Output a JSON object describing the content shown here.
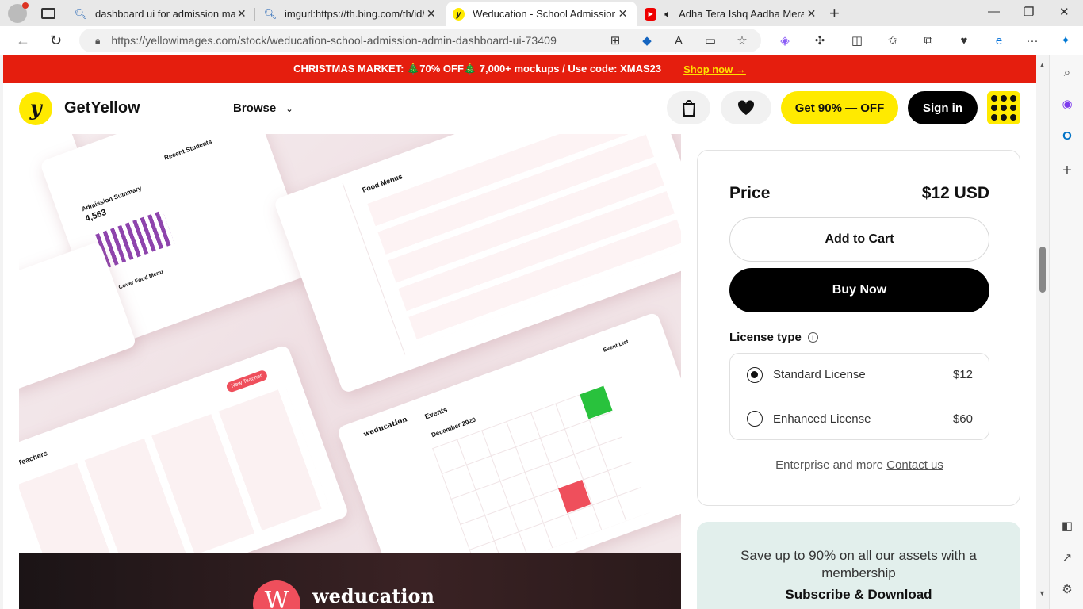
{
  "browser": {
    "tabs": [
      {
        "title": "dashboard ui for admission man",
        "icon": "search-icon"
      },
      {
        "title": "imgurl:https://th.bing.com/th/id/",
        "icon": "search-icon"
      },
      {
        "title": "Weducation - School Admission",
        "icon": "getyellow-favicon"
      },
      {
        "title": "Adha Tera Ishq Aadha Mera",
        "icon": "youtube-icon"
      }
    ],
    "url": "https://yellowimages.com/stock/weducation-school-admission-admin-dashboard-ui-73409"
  },
  "promo": {
    "text": "CHRISTMAS MARKET: 🎄70% OFF🎄 7,000+ mockups / Use code: XMAS23",
    "link": "Shop now →"
  },
  "header": {
    "brand": "GetYellow",
    "logo_letter": "y",
    "browse": "Browse",
    "deal_button": "Get 90% — OFF",
    "signin_button": "Sign in"
  },
  "preview": {
    "brand_name": "weducation",
    "brand_letter": "W",
    "labels": {
      "admission": "Admission Summary",
      "admission_value": "4,563",
      "recent_students": "Recent Students",
      "cover_food": "Cover Food Menu",
      "food_menus": "Food Menus",
      "teachers": "Teachers",
      "events": "Events",
      "month": "December 2020",
      "new_teacher": "New Teacher",
      "event_list": "Event List",
      "weducation_card": "weducation"
    }
  },
  "product": {
    "price_label": "Price",
    "price_value": "$12 USD",
    "add_to_cart": "Add to Cart",
    "buy_now": "Buy Now",
    "license_title": "License type",
    "licenses": [
      {
        "name": "Standard License",
        "price": "$12",
        "selected": true
      },
      {
        "name": "Enhanced License",
        "price": "$60",
        "selected": false
      }
    ],
    "enterprise_text": "Enterprise and more",
    "contact_link": "Contact us"
  },
  "membership": {
    "text": "Save up to 90% on all our assets with a membership",
    "cta": "Subscribe & Download"
  },
  "colors": {
    "promo_red": "#e51e0e",
    "brand_yellow": "#ffea00",
    "accent_pink": "#ef4f5c",
    "member_bg": "#e2efec"
  }
}
